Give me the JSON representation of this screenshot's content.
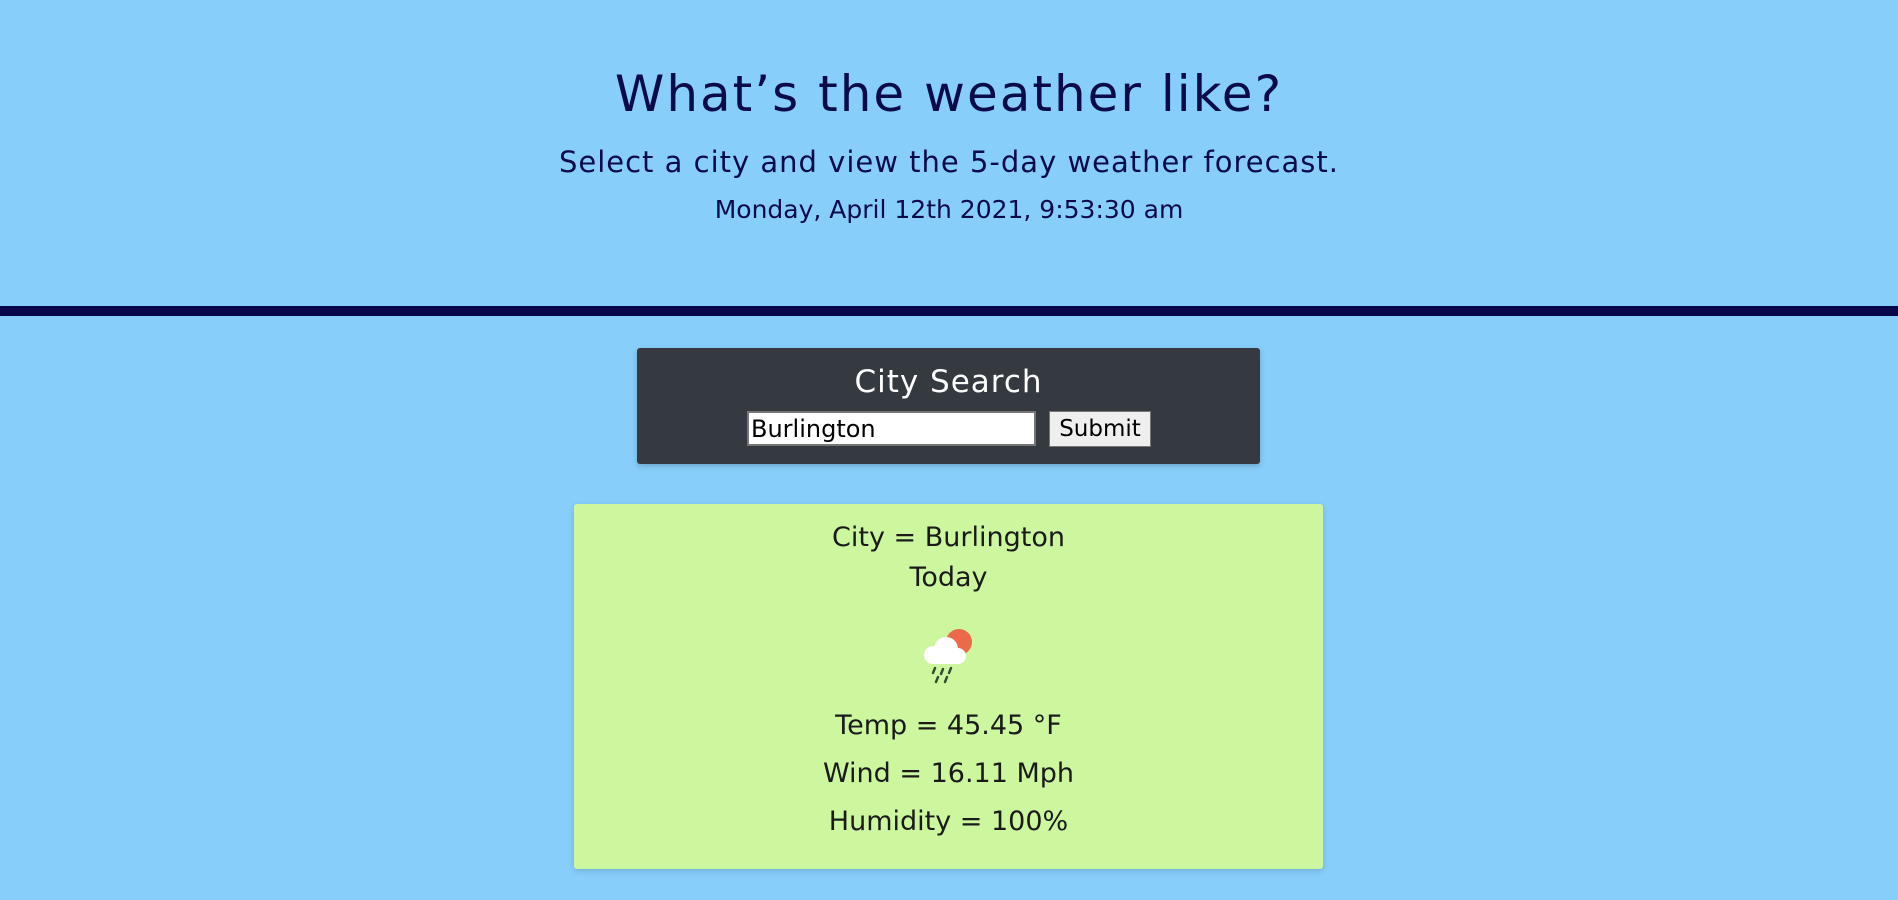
{
  "header": {
    "title": "What’s the weather like?",
    "subtitle": "Select a city and view the 5-day weather forecast.",
    "datetime": "Monday, April 12th 2021, 9:53:30 am"
  },
  "search": {
    "title": "City Search",
    "input_value": "Burlington",
    "submit_label": "Submit"
  },
  "weather": {
    "city": "City = Burlington",
    "day": "Today",
    "icon": "cloud-rain-sun-icon",
    "temp": "Temp = 45.45 °F",
    "wind": "Wind = 16.11 Mph",
    "humidity": "Humidity = 100%"
  },
  "colors": {
    "background": "#87cefa",
    "divider": "#06064a",
    "search_panel": "#343a40",
    "weather_card": "#ccf79f",
    "text": "#0b0b4a"
  }
}
